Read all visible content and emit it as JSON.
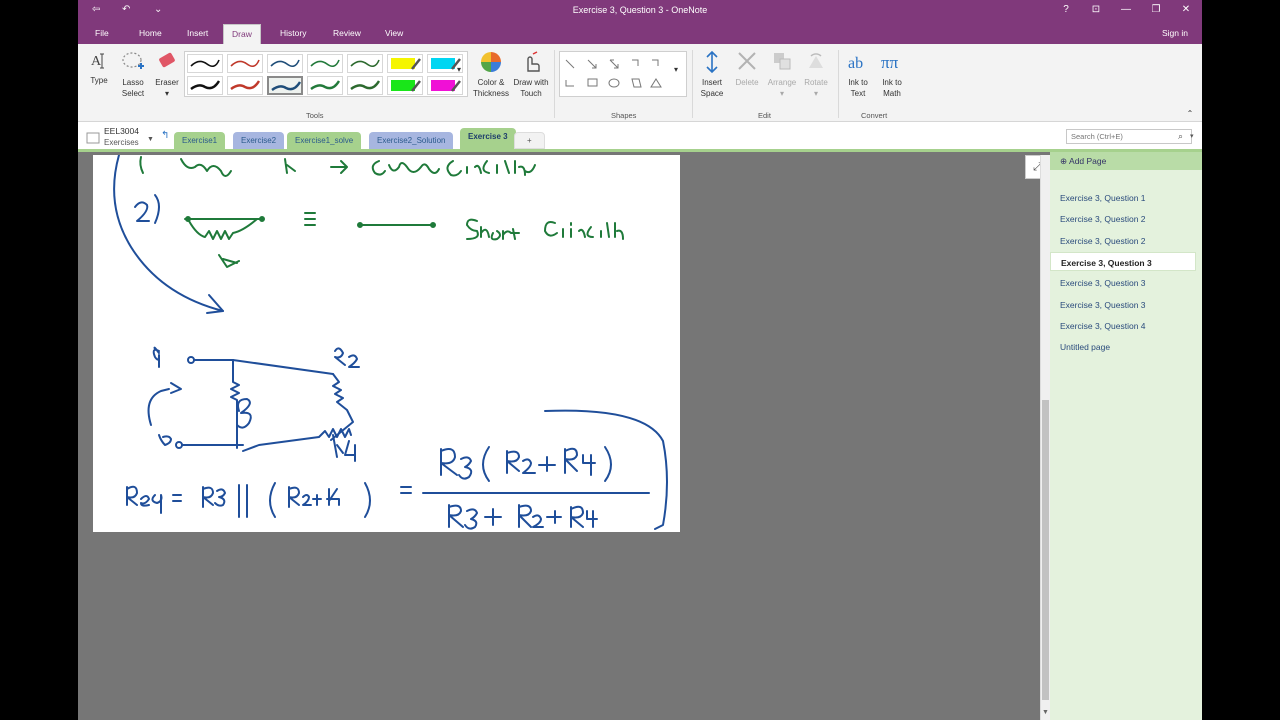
{
  "window": {
    "title": "Exercise 3, Question 3 - OneNote",
    "buttons": {
      "help": "?",
      "ribbon_opts": "⊡",
      "minimize": "—",
      "restore": "❐",
      "close": "✕"
    }
  },
  "ribbon_tabs": [
    "File",
    "Home",
    "Insert",
    "Draw",
    "History",
    "Review",
    "View"
  ],
  "active_tab": "Draw",
  "sign_in": "Sign in",
  "ribbon": {
    "tools": {
      "type": "Type",
      "lasso_line1": "Lasso",
      "lasso_line2": "Select",
      "eraser": "Eraser",
      "label": "Tools"
    },
    "color_thickness": {
      "line1": "Color &",
      "line2": "Thickness"
    },
    "draw_touch": {
      "line1": "Draw with",
      "line2": "Touch"
    },
    "shapes_label": "Shapes",
    "edit": {
      "insert_line1": "Insert",
      "insert_line2": "Space",
      "delete": "Delete",
      "arrange": "Arrange",
      "rotate": "Rotate",
      "label": "Edit"
    },
    "convert": {
      "ink_text_line1": "Ink to",
      "ink_text_line2": "Text",
      "ink_math_line1": "Ink to",
      "ink_math_line2": "Math",
      "label": "Convert"
    }
  },
  "pens": [
    {
      "color": "#111111",
      "thin": true
    },
    {
      "color": "#c0392b",
      "thin": true
    },
    {
      "color": "#1f4e79",
      "thin": true
    },
    {
      "color": "#237a3b",
      "thin": true
    },
    {
      "color": "#2d6a2f",
      "thin": true
    },
    {
      "color": "#f5f500",
      "thin": false
    },
    {
      "color": "#00d6f2",
      "thin": false
    },
    {
      "color": "#111111",
      "thin": false
    },
    {
      "color": "#c0392b",
      "thin": false
    },
    {
      "color": "#1f4e79",
      "thin": false
    },
    {
      "color": "#237a3b",
      "thin": false
    },
    {
      "color": "#2d6a2f",
      "thin": false
    },
    {
      "color": "#19e619",
      "thin": false
    },
    {
      "color": "#f010d6",
      "thin": false
    }
  ],
  "notebook": {
    "name": "EEL3004",
    "section_group": "Exercises"
  },
  "section_tabs": [
    {
      "label": "Exercise1",
      "color": "#a6d18d"
    },
    {
      "label": "Exercise2",
      "color": "#a7b6e0"
    },
    {
      "label": "Exercise1_solve",
      "color": "#a6d18d"
    },
    {
      "label": "Exercise2_Solution",
      "color": "#a7b6e0"
    },
    {
      "label": "Exercise 3",
      "color": "#a6d18d"
    }
  ],
  "active_section": "Exercise 3",
  "add_section": "+",
  "search_placeholder": "Search (Ctrl+E)",
  "add_page": "Add Page",
  "pages": [
    "Exercise 3, Question 1",
    "Exercise 3, Question 2",
    "Exercise 3, Question 2",
    "Exercise 3, Question 3",
    "Exercise 3, Question 3",
    "Exercise 3, Question 3",
    "Exercise 3, Question 4",
    "Untitled page"
  ],
  "selected_page_index": 3,
  "colors": {
    "accent": "#80397b",
    "ink_green": "#1f7a3a",
    "ink_blue": "#1f4e9a",
    "section_green": "#a6d18d"
  }
}
